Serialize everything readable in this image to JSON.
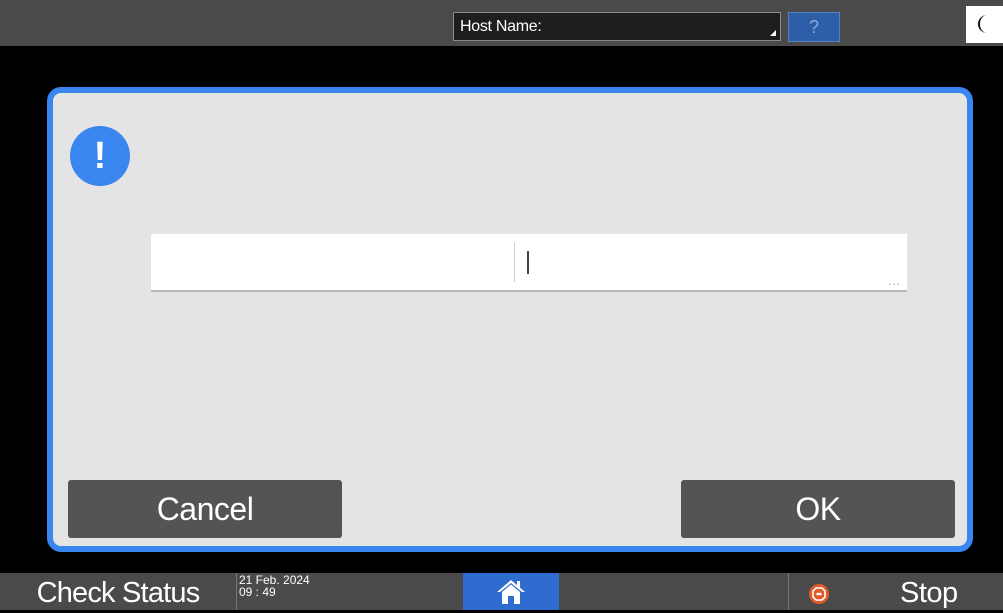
{
  "header": {
    "host_name_label": "Host Name:",
    "help_label": "?",
    "help_icon": "question-mark-icon",
    "energy_saver_icon": "moon-icon"
  },
  "dialog": {
    "alert_icon": "exclamation-icon",
    "alert_symbol": "!",
    "input_value": "",
    "input_more_indicator": "...",
    "cancel_label": "Cancel",
    "ok_label": "OK",
    "border_color": "#3a86f0"
  },
  "footer": {
    "check_status_label": "Check Status",
    "date": "21 Feb. 2024",
    "time": "09 : 49",
    "home_icon": "home-icon",
    "stop_icon": "stop-icon",
    "stop_label": "Stop",
    "home_color": "#2f6cd0",
    "stop_color": "#e05a2a"
  }
}
